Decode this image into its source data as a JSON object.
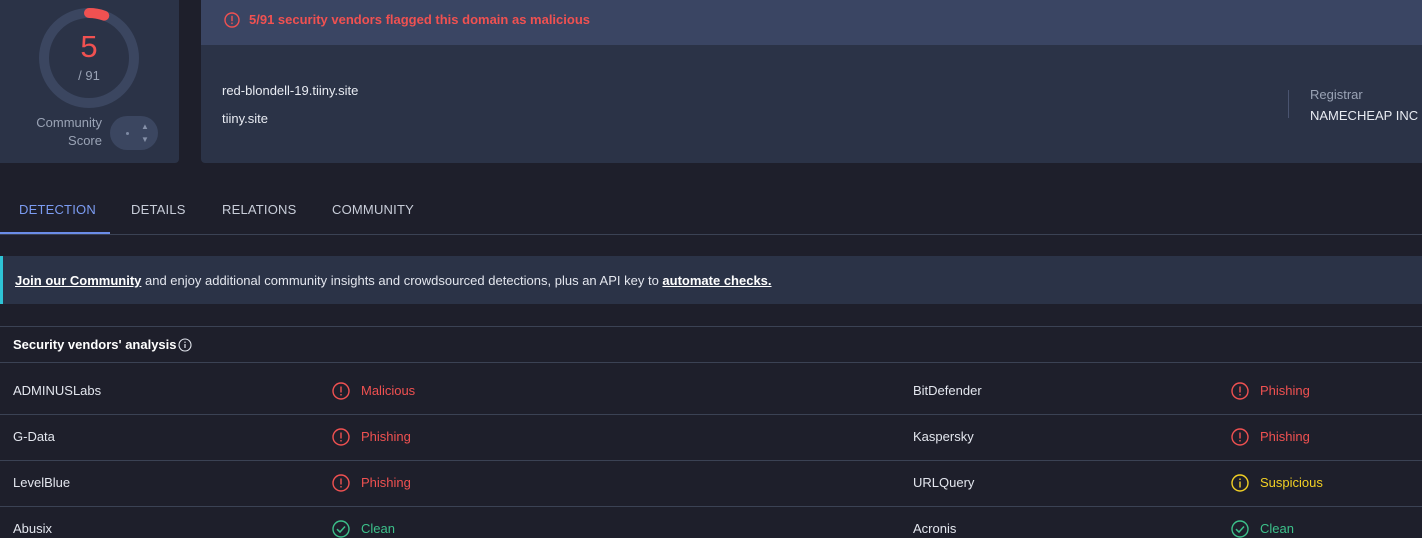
{
  "score": {
    "detections": "5",
    "total": "/ 91",
    "community_label_1": "Community",
    "community_label_2": "Score",
    "detection_fraction": 0.055,
    "color": "#f05151"
  },
  "alert": {
    "text": "5/91 security vendors flagged this domain as malicious",
    "icon": "alert-circle-icon",
    "color": "#f05151"
  },
  "domain": {
    "name": "red-blondell-19.tiiny.site",
    "parent": "tiiny.site",
    "registrar_label": "Registrar",
    "registrar_value": "NAMECHEAP INC"
  },
  "tabs": [
    {
      "label": "DETECTION",
      "active": true
    },
    {
      "label": "DETAILS",
      "active": false
    },
    {
      "label": "RELATIONS",
      "active": false
    },
    {
      "label": "COMMUNITY",
      "active": false
    }
  ],
  "banner": {
    "link1": "Join our Community",
    "middle": " and enjoy additional community insights and crowdsourced detections, plus an API key to ",
    "link2": "automate checks."
  },
  "vendors": {
    "title": "Security vendors' analysis",
    "rows": [
      {
        "left": {
          "name": "ADMINUSLabs",
          "verdict": "Malicious",
          "type": "malicious"
        },
        "right": {
          "name": "BitDefender",
          "verdict": "Phishing",
          "type": "malicious"
        }
      },
      {
        "left": {
          "name": "G-Data",
          "verdict": "Phishing",
          "type": "malicious"
        },
        "right": {
          "name": "Kaspersky",
          "verdict": "Phishing",
          "type": "malicious"
        }
      },
      {
        "left": {
          "name": "LevelBlue",
          "verdict": "Phishing",
          "type": "malicious"
        },
        "right": {
          "name": "URLQuery",
          "verdict": "Suspicious",
          "type": "suspicious"
        }
      },
      {
        "left": {
          "name": "Abusix",
          "verdict": "Clean",
          "type": "clean"
        },
        "right": {
          "name": "Acronis",
          "verdict": "Clean",
          "type": "clean"
        }
      }
    ]
  },
  "colors": {
    "malicious": "#f05151",
    "suspicious": "#f2d024",
    "clean": "#3cc08a",
    "accent": "#7c9cf2"
  }
}
